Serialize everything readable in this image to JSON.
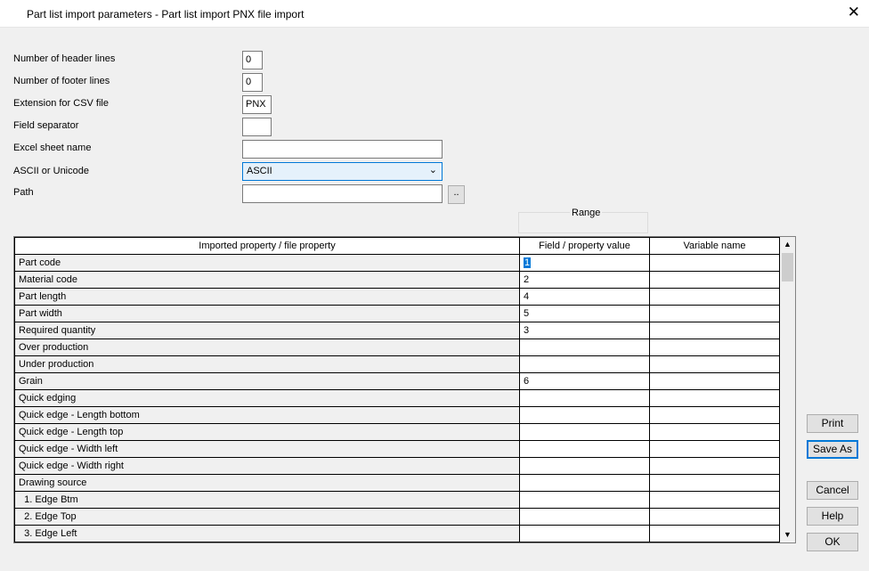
{
  "window": {
    "title": "Part list import parameters - Part list import PNX file import",
    "close": "✕"
  },
  "form": {
    "header_lines_label": "Number of header lines",
    "header_lines_value": "0",
    "footer_lines_label": "Number of footer lines",
    "footer_lines_value": "0",
    "extension_label": "Extension for CSV file",
    "extension_value": "PNX",
    "separator_label": "Field separator",
    "separator_value": "",
    "sheet_label": "Excel sheet name",
    "sheet_value": "",
    "encoding_label": "ASCII or Unicode",
    "encoding_value": "ASCII",
    "path_label": "Path",
    "path_value": "",
    "browse_label": ".."
  },
  "range_label": "Range",
  "grid": {
    "headers": [
      "Imported property / file property",
      "Field / property value",
      "Variable name"
    ],
    "rows": [
      [
        "Part code",
        "1",
        ""
      ],
      [
        "Material code",
        "2",
        ""
      ],
      [
        "Part length",
        "4",
        ""
      ],
      [
        "Part width",
        "5",
        ""
      ],
      [
        "Required quantity",
        "3",
        ""
      ],
      [
        "Over production",
        "",
        ""
      ],
      [
        "Under production",
        "",
        ""
      ],
      [
        "Grain",
        "6",
        ""
      ],
      [
        "Quick edging",
        "",
        ""
      ],
      [
        "Quick edge - Length bottom",
        "",
        ""
      ],
      [
        "Quick edge - Length top",
        "",
        ""
      ],
      [
        "Quick edge - Width left",
        "",
        ""
      ],
      [
        "Quick edge - Width right",
        "",
        ""
      ],
      [
        "Drawing source",
        "",
        ""
      ],
      [
        "  1. Edge Btm",
        "",
        ""
      ],
      [
        "  2. Edge Top",
        "",
        ""
      ],
      [
        "  3. Edge Left",
        "",
        ""
      ]
    ]
  },
  "buttons": {
    "print": "Print",
    "save_as": "Save As",
    "cancel": "Cancel",
    "help": "Help",
    "ok": "OK"
  },
  "colors": {
    "accent": "#0078d7",
    "dialog_bg": "#f0f0f0"
  }
}
